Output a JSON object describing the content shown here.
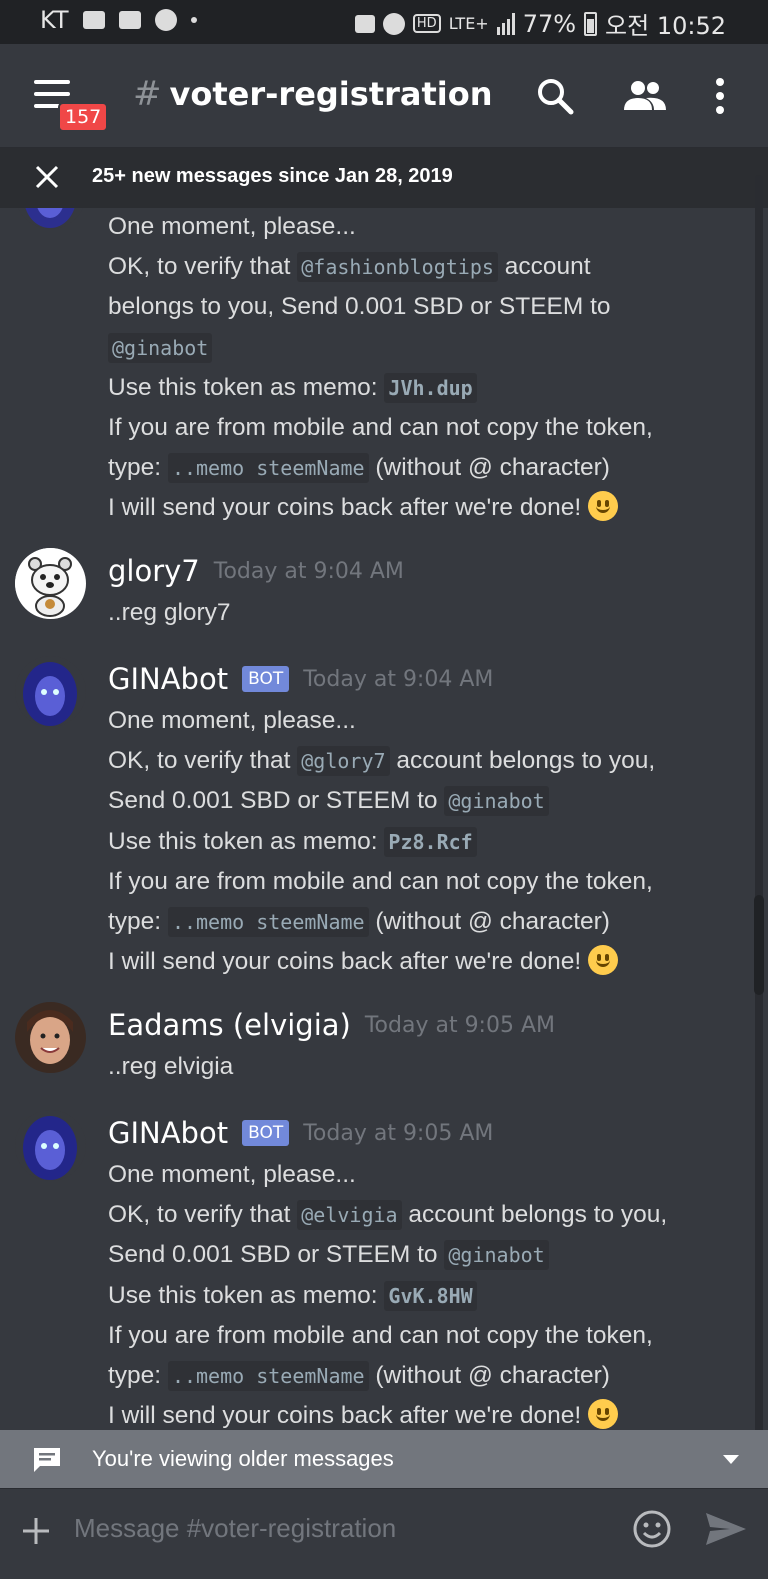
{
  "status": {
    "carrier": "KT",
    "network": "LTE+",
    "battery": "77%",
    "time": "오전 10:52"
  },
  "header": {
    "hash": "#",
    "channel": "voter-registration",
    "badge": "157"
  },
  "new_messages": {
    "text": "25+ new messages since Jan 28, 2019"
  },
  "messages": {
    "m1": {
      "l1": "One moment, please...",
      "l2a": "OK, to verify that ",
      "l2code": "@fashionblogtips",
      "l2b": " account",
      "l3": "belongs to you, Send 0.001 SBD or STEEM to",
      "l4code": "@ginabot",
      "l5a": "Use this token as memo: ",
      "l5code": "JVh.dup",
      "l6": "If you are from mobile and can not copy the token,",
      "l7a": "type: ",
      "l7code": "..memo steemName",
      "l7b": " (without @ character)",
      "l8": "I will send your coins back after we're done! "
    },
    "m2": {
      "author": "glory7",
      "time": "Today at 9:04 AM",
      "body": "..reg glory7"
    },
    "m3": {
      "author": "GINAbot",
      "bot": "BOT",
      "time": "Today at 9:04 AM",
      "l1": "One moment, please...",
      "l2a": "OK, to verify that ",
      "l2code": "@glory7",
      "l2b": " account belongs to you,",
      "l3a": "Send 0.001 SBD or STEEM to ",
      "l3code": "@ginabot",
      "l4a": "Use this token as memo: ",
      "l4code": "Pz8.Rcf",
      "l5": "If you are from mobile and can not copy the token,",
      "l6a": "type: ",
      "l6code": "..memo steemName",
      "l6b": " (without @ character)",
      "l7": "I will send your coins back after we're done! "
    },
    "m4": {
      "author": "Eadams (elvigia)",
      "time": "Today at 9:05 AM",
      "body": "..reg elvigia"
    },
    "m5": {
      "author": "GINAbot",
      "bot": "BOT",
      "time": "Today at 9:05 AM",
      "l1": "One moment, please...",
      "l2a": "OK, to verify that ",
      "l2code": "@elvigia",
      "l2b": " account belongs to you,",
      "l3a": "Send 0.001 SBD or STEEM to ",
      "l3code": "@ginabot",
      "l4a": "Use this token as memo: ",
      "l4code": "GvK.8HW",
      "l5": "If you are from mobile and can not copy the token,",
      "l6a": "type: ",
      "l6code": "..memo steemName",
      "l6b": " (without @ character)",
      "l7": "I will send your coins back after we're done! "
    }
  },
  "older_bar": {
    "text": "You're viewing older messages"
  },
  "composer": {
    "placeholder": "Message #voter-registration"
  },
  "colors": {
    "background": "#36393f",
    "bot_badge": "#7289da",
    "unread_badge": "#f04747"
  },
  "icons": [
    "menu-icon",
    "search-icon",
    "members-icon",
    "more-vert-icon",
    "close-icon",
    "smiley-emoji",
    "chat-bubble-icon",
    "chevron-down-icon",
    "plus-icon",
    "emoji-icon",
    "send-icon"
  ]
}
